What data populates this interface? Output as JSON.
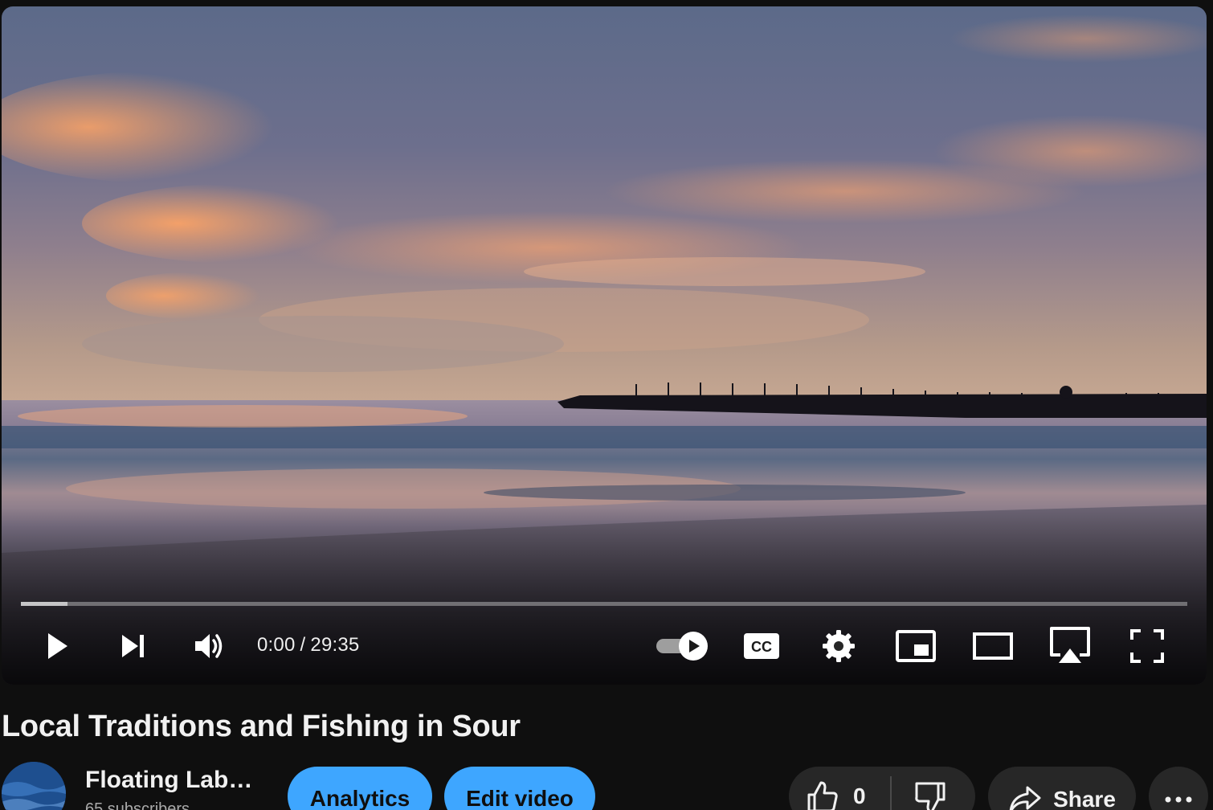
{
  "player": {
    "current_time": "0:00",
    "separator": "/",
    "duration": "29:35",
    "progress_played_fraction": 0,
    "progress_buffered_fraction": 0.04,
    "autoplay_on": true,
    "controls": {
      "play": "play-icon",
      "next": "next-icon",
      "volume": "volume-icon",
      "autoplay": "autoplay-toggle-icon",
      "captions": "captions-icon",
      "settings": "gear-icon",
      "miniplayer": "miniplayer-icon",
      "theater": "theater-mode-icon",
      "cast": "airplay-icon",
      "fullscreen": "fullscreen-icon"
    }
  },
  "video": {
    "title": "Local Traditions and Fishing in Sour"
  },
  "channel": {
    "name": "Floating Lab…",
    "subscribers": "65 subscribers"
  },
  "actions": {
    "analytics_label": "Analytics",
    "edit_label": "Edit video",
    "like_count": "0",
    "share_label": "Share",
    "more_icon": "more-horizontal-icon",
    "like_icon": "thumbs-up-icon",
    "dislike_icon": "thumbs-down-icon",
    "share_icon": "share-arrow-icon"
  },
  "colors": {
    "background": "#0f0f0f",
    "accent_blue": "#3ea6ff",
    "button_dark": "#272727",
    "text_primary": "#f1f1f1",
    "text_secondary": "#aaaaaa"
  }
}
